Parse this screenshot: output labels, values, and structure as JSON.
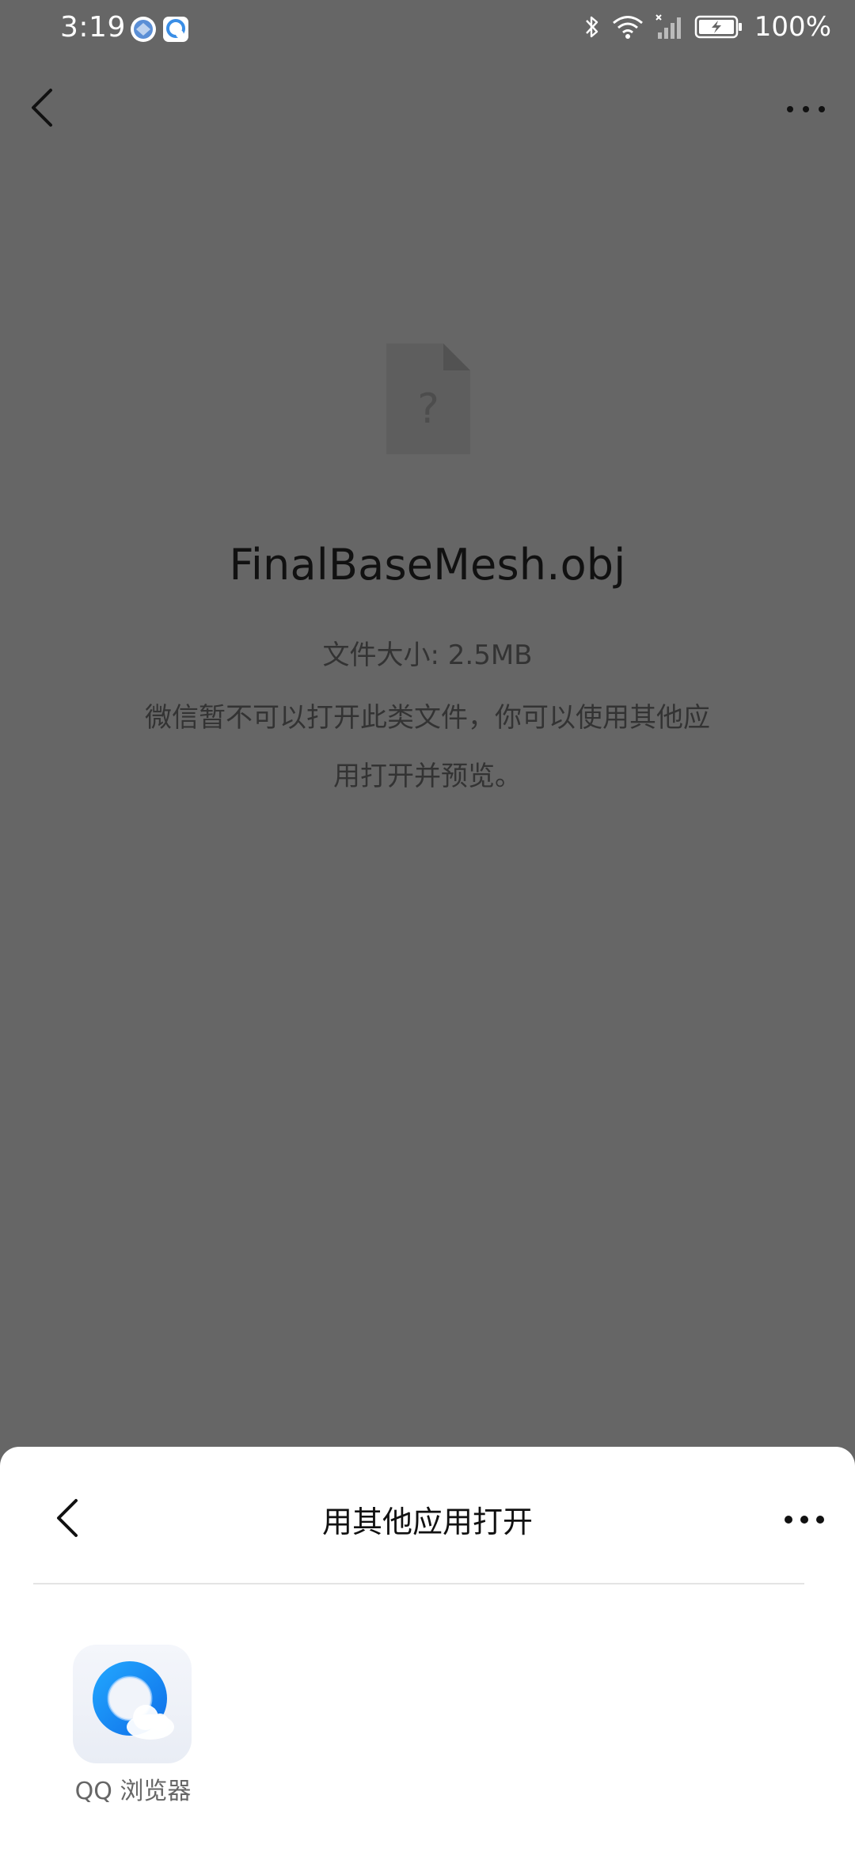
{
  "status_bar": {
    "time": "3:19",
    "battery": "100%",
    "icons": [
      "browser-notification-icon",
      "qq-browser-notification-icon",
      "bluetooth-icon",
      "wifi-icon",
      "signal-icon",
      "battery-charging-icon"
    ]
  },
  "nav": {
    "back_icon": "chevron-left-icon",
    "more_icon": "more-dots-icon"
  },
  "file": {
    "icon": "unknown-file-icon",
    "name": "FinalBaseMesh.obj",
    "size": "文件大小: 2.5MB",
    "message": "微信暂不可以打开此类文件，你可以使用其他应用打开并预览。"
  },
  "sheet": {
    "title": "用其他应用打开",
    "apps": [
      {
        "label": "QQ 浏览器",
        "icon": "qq-browser-icon"
      }
    ]
  },
  "colors": {
    "overlay": "#666666",
    "sheet_bg": "#ffffff",
    "accent_blue": "#1a8cff"
  }
}
